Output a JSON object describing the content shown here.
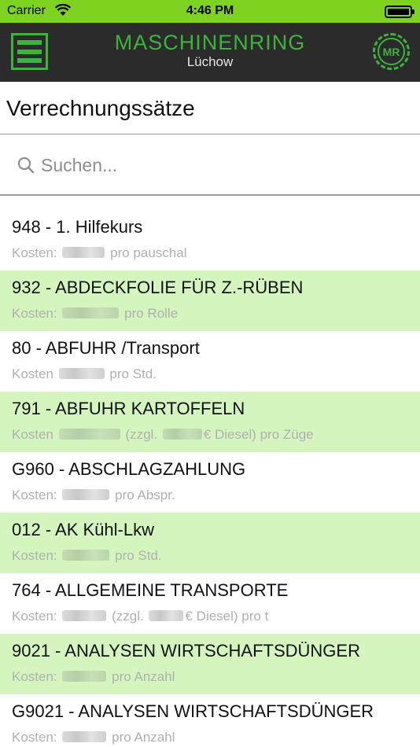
{
  "status_bar": {
    "carrier": "Carrier",
    "time": "4:46 PM"
  },
  "nav": {
    "brand_name": "MASCHINENRING",
    "brand_location": "Lüchow",
    "logo_text": "MR",
    "accent_color": "#3db33d",
    "menu_icon": "hamburger-menu-icon"
  },
  "page": {
    "title": "Verrechnungssätze"
  },
  "search": {
    "placeholder": "Suchen...",
    "value": "",
    "icon": "search-icon"
  },
  "items": [
    {
      "title": "948 - 1. Hilfekurs",
      "prefix": "Kosten:",
      "middle": "",
      "suffix": "pro pauschal"
    },
    {
      "title": "932 - ABDECKFOLIE FÜR Z.-RÜBEN",
      "prefix": "Kosten:",
      "middle": "",
      "suffix": "pro Rolle"
    },
    {
      "title": "80 - ABFUHR /Transport",
      "prefix": "Kosten",
      "middle": "",
      "suffix": "pro Std."
    },
    {
      "title": "791 - ABFUHR KARTOFFELN",
      "prefix": "Kosten",
      "middle": "(zzgl.",
      "suffix": "€ Diesel) pro Züge"
    },
    {
      "title": "G960 - ABSCHLAGZAHLUNG",
      "prefix": "Kosten:",
      "middle": "",
      "suffix": "pro Abspr."
    },
    {
      "title": "012 - AK Kühl-Lkw",
      "prefix": "Kosten:",
      "middle": "",
      "suffix": "pro Std."
    },
    {
      "title": "764 - ALLGEMEINE TRANSPORTE",
      "prefix": "Kosten:",
      "middle": "(zzgl.",
      "suffix": "€ Diesel) pro t"
    },
    {
      "title": "9021 - ANALYSEN WIRTSCHAFTSDÜNGER",
      "prefix": "Kosten:",
      "middle": "",
      "suffix": "pro Anzahl"
    },
    {
      "title": "G9021 - ANALYSEN WIRTSCHAFTSDÜNGER",
      "prefix": "Kosten:",
      "middle": "",
      "suffix": "pro Anzahl"
    }
  ],
  "colors": {
    "status_bar": "#7ed321",
    "nav_bar": "#2b2b2b",
    "alt_row": "#d4f5be"
  }
}
